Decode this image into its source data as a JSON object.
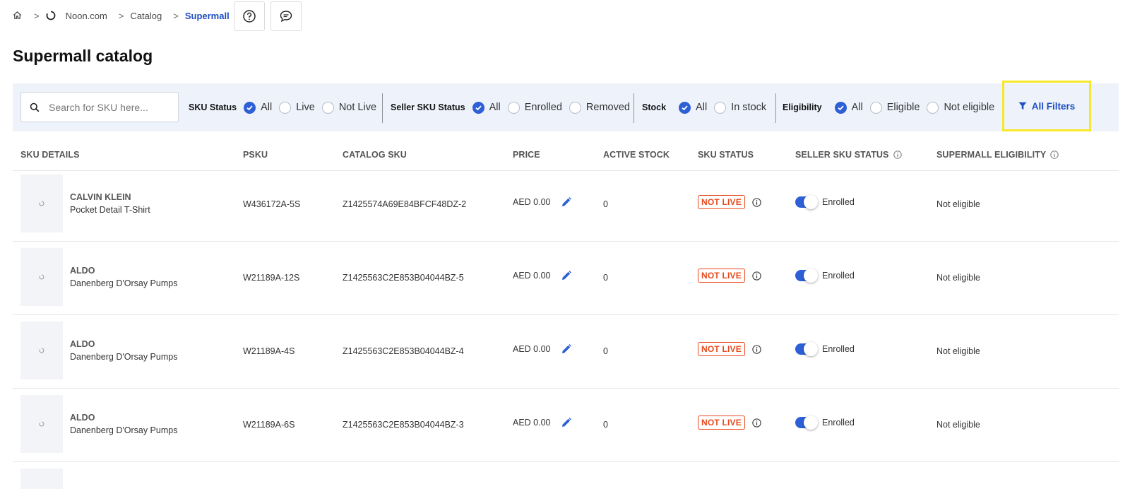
{
  "breadcrumb": {
    "items": [
      "Noon.com",
      "Catalog"
    ],
    "active": "Supermall"
  },
  "page": {
    "title": "Supermall catalog"
  },
  "search": {
    "placeholder": "Search for SKU here..."
  },
  "filters": {
    "sku_status": {
      "label": "SKU Status",
      "options": [
        "All",
        "Live",
        "Not Live"
      ],
      "selected": "All"
    },
    "seller_sku_status": {
      "label": "Seller SKU Status",
      "options": [
        "All",
        "Enrolled",
        "Removed"
      ],
      "selected": "All"
    },
    "stock": {
      "label": "Stock",
      "options": [
        "All",
        "In stock"
      ],
      "selected": "All"
    },
    "eligibility": {
      "label": "Eligibility",
      "options": [
        "All",
        "Eligible",
        "Not eligible"
      ],
      "selected": "All"
    },
    "all_filters_label": "All Filters"
  },
  "table": {
    "columns": [
      "SKU DETAILS",
      "PSKU",
      "CATALOG SKU",
      "PRICE",
      "ACTIVE STOCK",
      "SKU STATUS",
      "SELLER SKU STATUS",
      "SUPERMALL ELIGIBILITY"
    ],
    "rows": [
      {
        "brand": "CALVIN KLEIN",
        "name": "Pocket Detail T-Shirt",
        "psku": "W436172A-5S",
        "catalog_sku": "Z1425574A69E84BFCF48DZ-2",
        "price": "AED 0.00",
        "active_stock": "0",
        "sku_status": "NOT LIVE",
        "seller_status": "Enrolled",
        "seller_enabled": true,
        "eligibility": "Not eligible"
      },
      {
        "brand": "ALDO",
        "name": "Danenberg D'Orsay Pumps",
        "psku": "W21189A-12S",
        "catalog_sku": "Z1425563C2E853B04044BZ-5",
        "price": "AED 0.00",
        "active_stock": "0",
        "sku_status": "NOT LIVE",
        "seller_status": "Enrolled",
        "seller_enabled": true,
        "eligibility": "Not eligible"
      },
      {
        "brand": "ALDO",
        "name": "Danenberg D'Orsay Pumps",
        "psku": "W21189A-4S",
        "catalog_sku": "Z1425563C2E853B04044BZ-4",
        "price": "AED 0.00",
        "active_stock": "0",
        "sku_status": "NOT LIVE",
        "seller_status": "Enrolled",
        "seller_enabled": true,
        "eligibility": "Not eligible"
      },
      {
        "brand": "ALDO",
        "name": "Danenberg D'Orsay Pumps",
        "psku": "W21189A-6S",
        "catalog_sku": "Z1425563C2E853B04044BZ-3",
        "price": "AED 0.00",
        "active_stock": "0",
        "sku_status": "NOT LIVE",
        "seller_status": "Enrolled",
        "seller_enabled": true,
        "eligibility": "Not eligible"
      }
    ]
  },
  "colors": {
    "accent": "#2d5fd6",
    "badge_red": "#e84a1c",
    "filter_bg": "#eef2fb",
    "highlight": "#f7e929"
  },
  "icons": {
    "home": "home-icon",
    "loading": "loading-icon",
    "help": "help-icon",
    "chat": "chat-icon",
    "search": "search-icon",
    "filter": "filter-icon",
    "edit": "pencil-icon",
    "info": "info-icon"
  }
}
